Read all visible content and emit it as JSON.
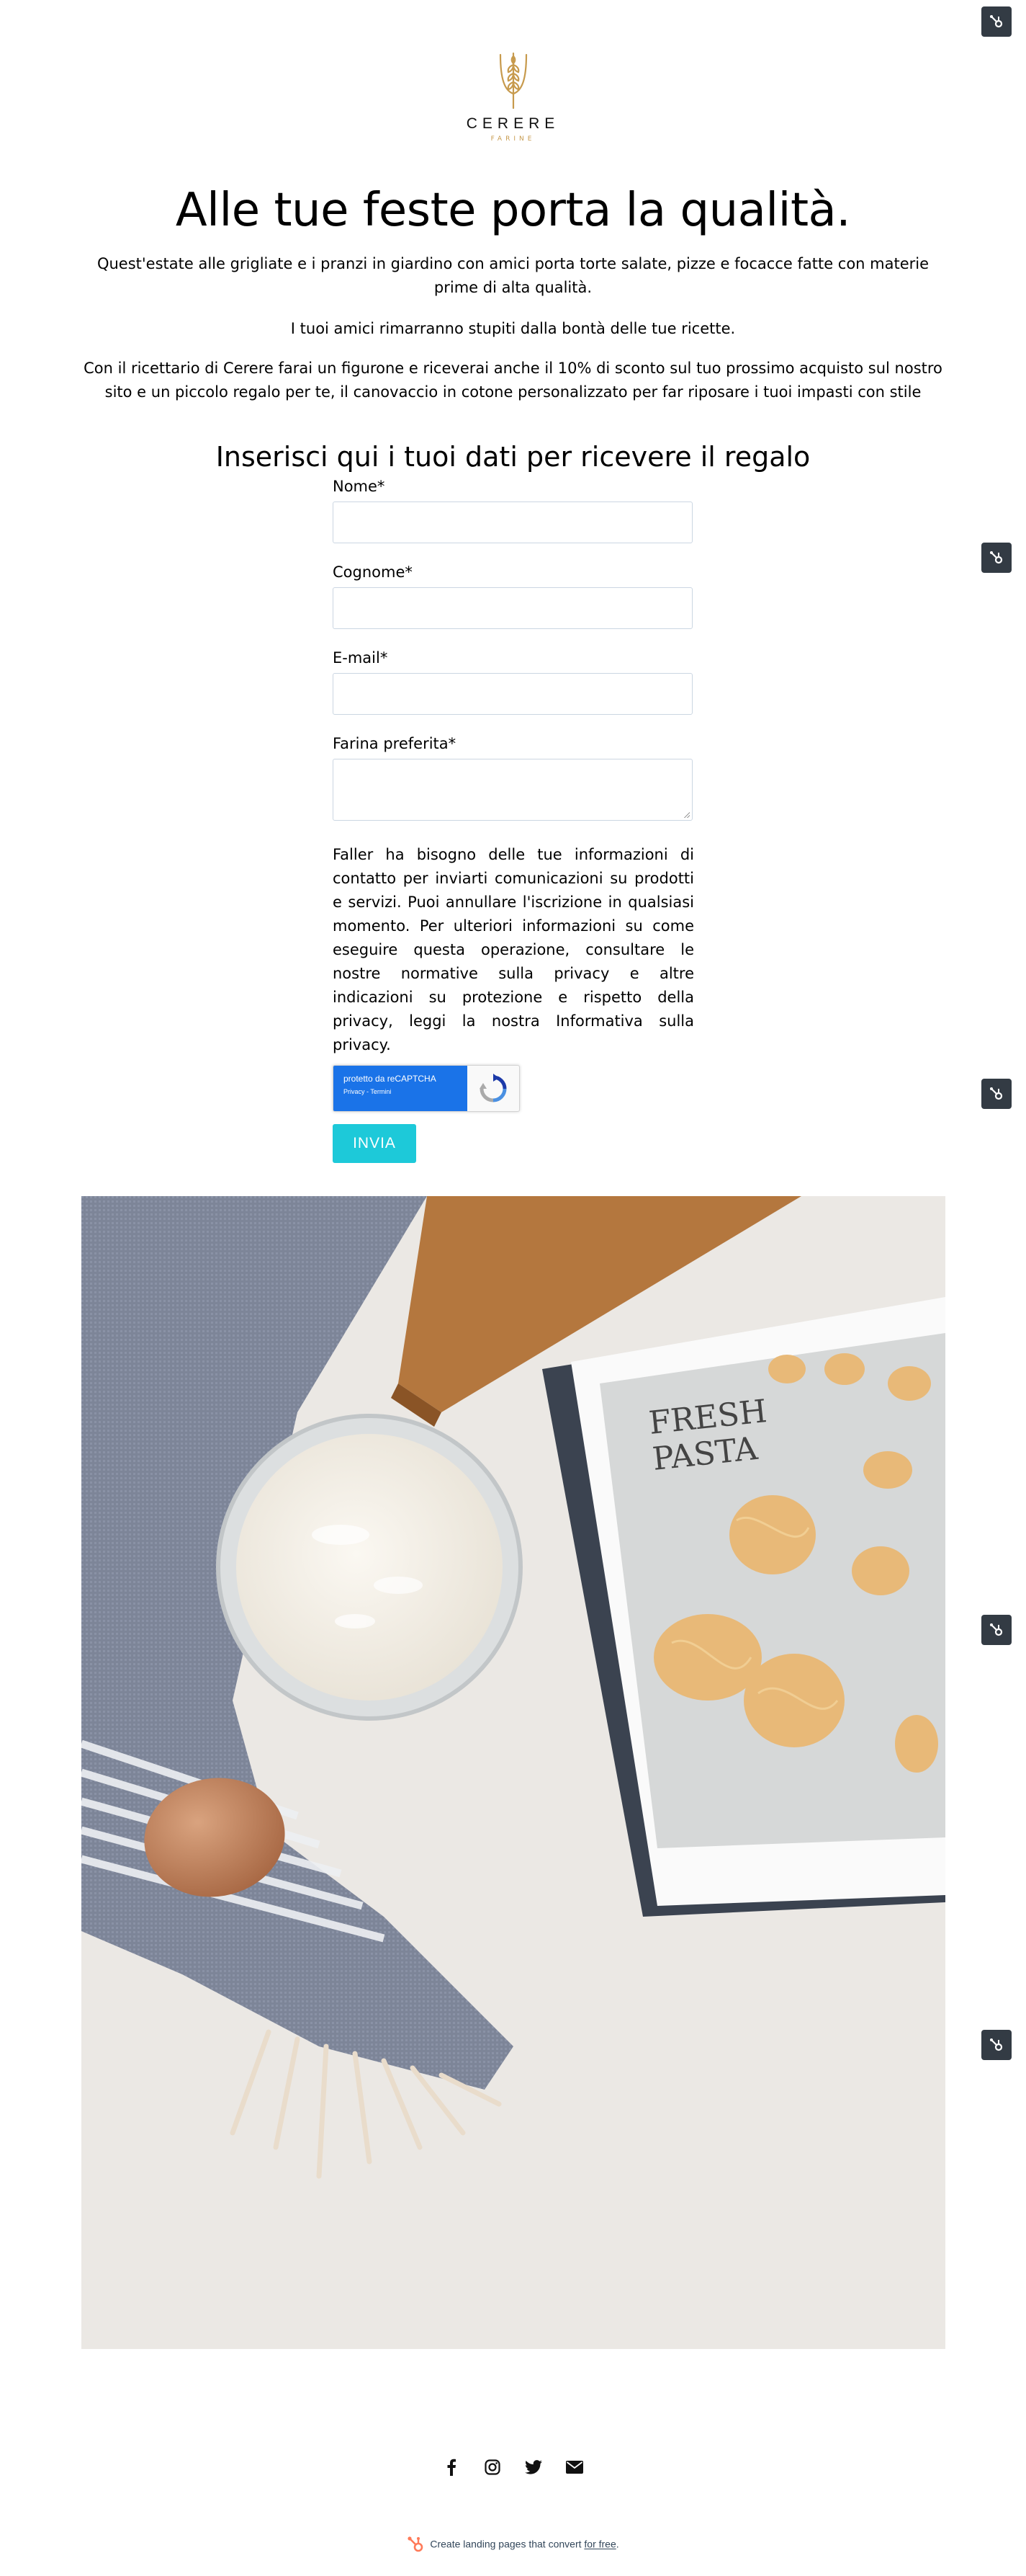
{
  "brand": {
    "name": "CERERE",
    "tagline": "FARINE",
    "accent_color": "#c79a4d"
  },
  "hero_heading": "Alle tue feste porta la qualità.",
  "intro": {
    "p1": "Quest'estate alle grigliate e i pranzi in giardino con amici porta torte salate, pizze e focacce fatte con materie prime di alta qualità.",
    "p2": "I tuoi amici rimarranno stupiti dalla bontà delle tue ricette.",
    "p3": "Con il ricettario di Cerere farai un figurone e riceverai anche il 10% di sconto sul tuo prossimo acquisto sul nostro sito e un piccolo regalo per te, il canovaccio in cotone personalizzato per far riposare i tuoi impasti con stile"
  },
  "form": {
    "title": "Inserisci qui i tuoi dati per ricevere il regalo",
    "fields": [
      {
        "label": "Nome*",
        "value": ""
      },
      {
        "label": "Cognome*",
        "value": ""
      },
      {
        "label": "E-mail*",
        "value": ""
      },
      {
        "label": "Farina preferita*",
        "value": ""
      }
    ],
    "legal": "Faller ha bisogno delle tue informazioni di contatto per inviarti comunicazioni su prodotti e servizi. Puoi annullare l'iscrizione in qualsiasi momento. Per ulteriori informazioni su come eseguire questa operazione, consultare le nostre normative sulla privacy e altre indicazioni su protezione e rispetto della privacy, leggi la nostra Informativa sulla privacy.",
    "recaptcha": {
      "line1": "protetto da reCAPTCHA",
      "line2": "Privacy - Termini"
    },
    "submit_label": "INVIA",
    "submit_color": "#1dc9d9"
  },
  "hero_image": {
    "magazine_title_line1": "FRESH",
    "magazine_title_line2": "PASTA",
    "icons": [
      "kitchen-towel",
      "flour-bowl",
      "egg",
      "cookbook"
    ]
  },
  "social": [
    "facebook-icon",
    "instagram-icon",
    "twitter-icon",
    "email-icon"
  ],
  "footer": {
    "text": "Create landing pages that convert ",
    "link": "for free",
    "suffix": "."
  },
  "editor_badge_icon": "hubspot-sprocket-icon"
}
